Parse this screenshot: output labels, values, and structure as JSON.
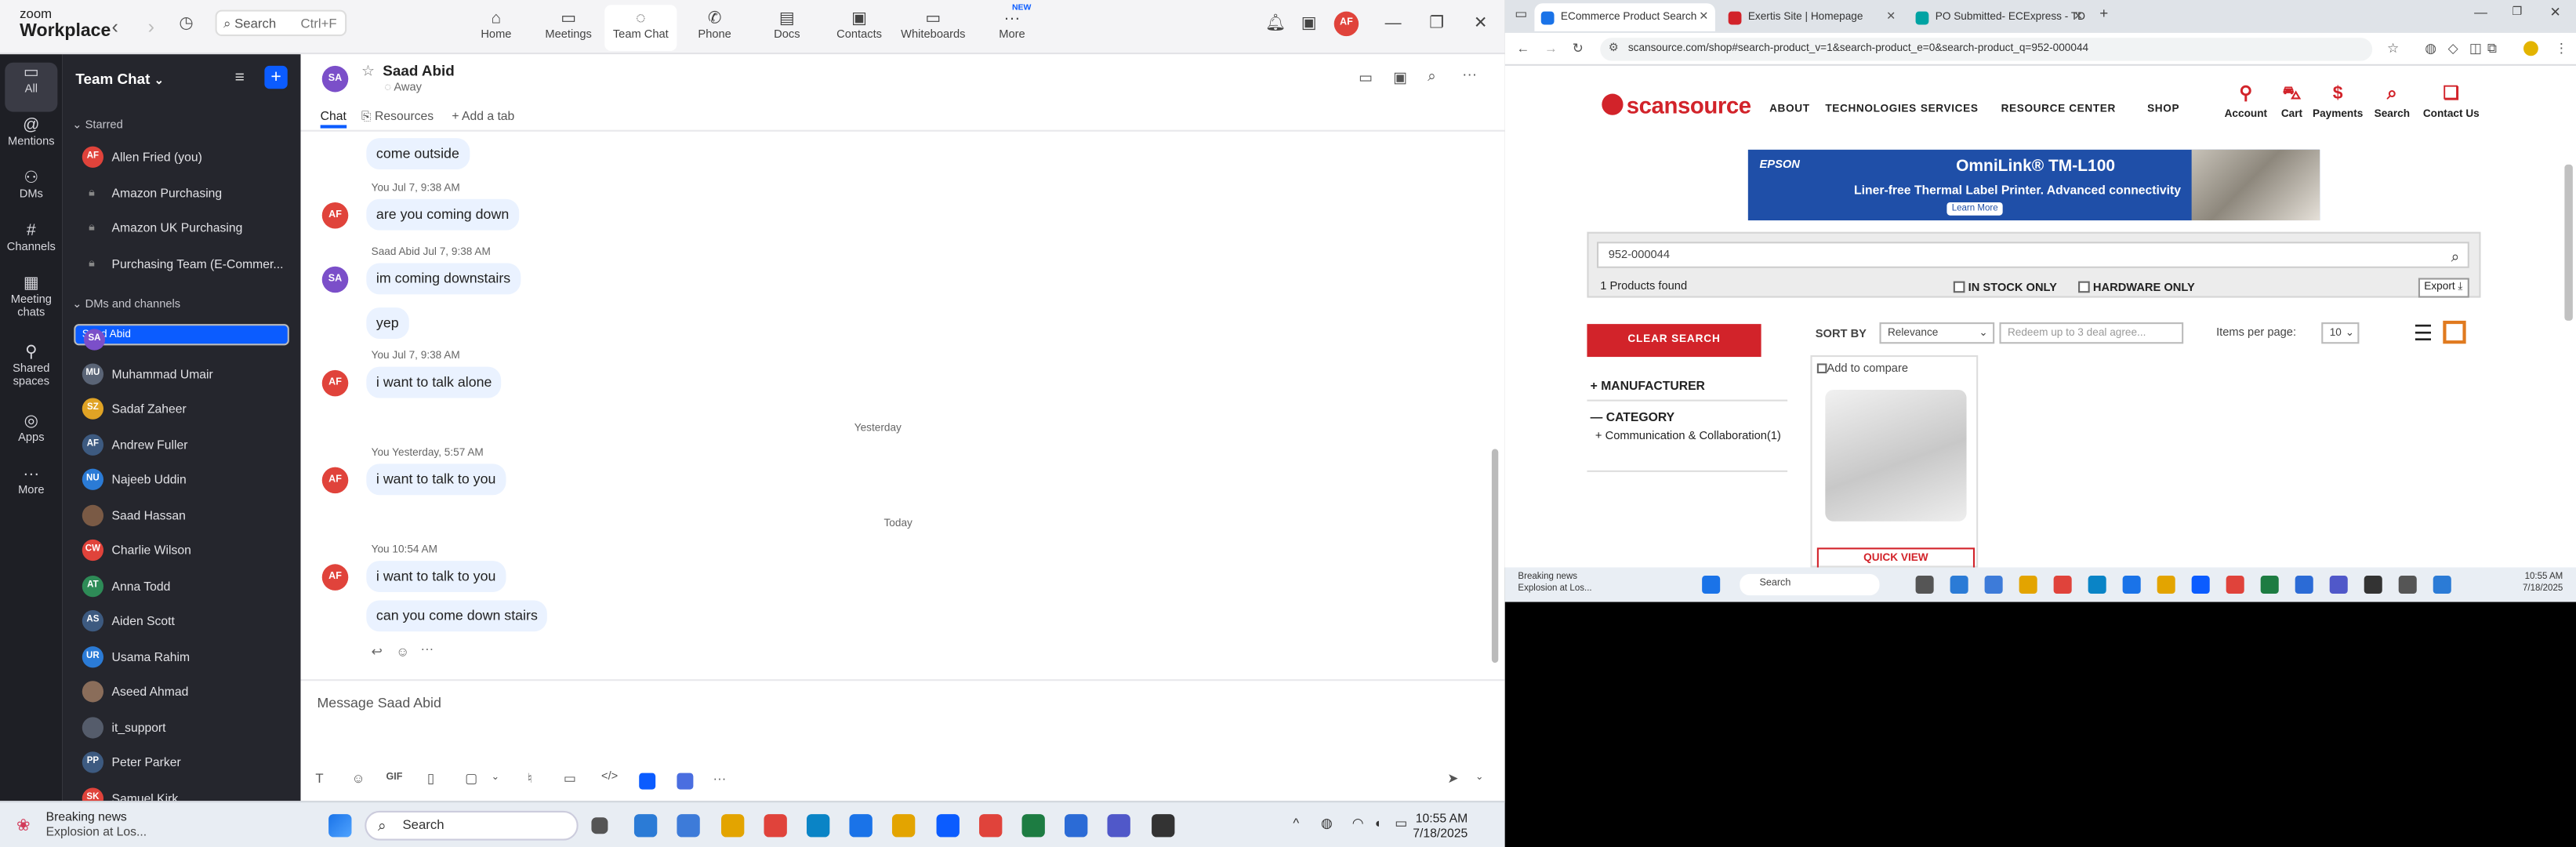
{
  "zoom": {
    "logo_small": "zoom",
    "logo_big": "Workplace",
    "search_label": "Search",
    "search_shortcut": "Ctrl+F",
    "nav": [
      {
        "label": "Home",
        "icon": "home-icon"
      },
      {
        "label": "Meetings",
        "icon": "video-icon"
      },
      {
        "label": "Team Chat",
        "icon": "chat-icon"
      },
      {
        "label": "Phone",
        "icon": "phone-icon"
      },
      {
        "label": "Docs",
        "icon": "docs-icon"
      },
      {
        "label": "Contacts",
        "icon": "contacts-icon"
      },
      {
        "label": "Whiteboards",
        "icon": "whiteboard-icon"
      },
      {
        "label": "More",
        "icon": "more-icon"
      }
    ],
    "new_badge": "NEW",
    "user_initials": "AF",
    "rail": [
      {
        "label": "All"
      },
      {
        "label": "Mentions"
      },
      {
        "label": "DMs"
      },
      {
        "label": "Channels"
      },
      {
        "label": "Meeting chats"
      },
      {
        "label": "Shared spaces"
      },
      {
        "label": "Apps"
      },
      {
        "label": "More"
      }
    ],
    "sidebar": {
      "title": "Team Chat",
      "starred_label": "Starred",
      "starred": [
        {
          "name": "Allen Fried (you)",
          "initials": "AF",
          "color": "#e0433b"
        },
        {
          "name": "Amazon Purchasing",
          "lock": true
        },
        {
          "name": "Amazon UK Purchasing",
          "lock": true
        },
        {
          "name": "Purchasing Team (E-Commer...",
          "lock": true
        }
      ],
      "dms_label": "DMs and channels",
      "dms": [
        {
          "name": "Saad Abid",
          "initials": "SA",
          "color": "#7b4fc9",
          "selected": true
        },
        {
          "name": "Muhammad Umair",
          "initials": "MU",
          "color": "#5a6476"
        },
        {
          "name": "Sadaf Zaheer",
          "initials": "SZ",
          "color": "#e0a325"
        },
        {
          "name": "Andrew Fuller",
          "initials": "AF",
          "color": "#3d5a80"
        },
        {
          "name": "Najeeb Uddin",
          "initials": "NU",
          "color": "#2b7bd6"
        },
        {
          "name": "Saad Hassan",
          "initials": "",
          "color": "#7a5a45"
        },
        {
          "name": "Charlie Wilson",
          "initials": "CW",
          "color": "#e0433b"
        },
        {
          "name": "Anna Todd",
          "initials": "AT",
          "color": "#2e8b57"
        },
        {
          "name": "Aiden Scott",
          "initials": "AS",
          "color": "#3d5a80"
        },
        {
          "name": "Usama Rahim",
          "initials": "UR",
          "color": "#2b7bd6"
        },
        {
          "name": "Aseed Ahmad",
          "initials": "",
          "color": "#8a6d5a"
        },
        {
          "name": "it_support",
          "initials": "",
          "color": "#555c6b"
        },
        {
          "name": "Peter Parker",
          "initials": "PP",
          "color": "#3d5a80"
        },
        {
          "name": "Samuel Kirk",
          "initials": "SK",
          "color": "#e0433b"
        }
      ]
    },
    "chat": {
      "name": "Saad Abid",
      "initials": "SA",
      "status": "Away",
      "tabs": [
        "Chat",
        "Resources",
        "+ Add a tab"
      ],
      "messages": [
        {
          "text": "come outside"
        },
        {
          "meta": "You Jul 7, 9:38 AM",
          "text": "are you coming down",
          "initials": "AF"
        },
        {
          "meta": "Saad Abid Jul 7, 9:38 AM",
          "text": "im coming downstairs",
          "initials": "SA"
        },
        {
          "text": "yep"
        },
        {
          "meta": "You Jul 7, 9:38 AM",
          "text": "i want to talk alone",
          "initials": "AF"
        },
        {
          "day": "Yesterday"
        },
        {
          "meta": "You Yesterday, 5:57 AM",
          "text": "i want to talk to you",
          "initials": "AF"
        },
        {
          "day": "Today"
        },
        {
          "meta": "You 10:54 AM",
          "text": "i want to talk to you",
          "initials": "AF"
        },
        {
          "text": "can you come down stairs"
        }
      ],
      "compose_placeholder": "Message Saad Abid",
      "gif_label": "GIF"
    }
  },
  "chrome": {
    "tabs": [
      {
        "title": "ECommerce Product Search",
        "color": "#1a73e8"
      },
      {
        "title": "Exertis Site | Homepage",
        "color": "#d2232a"
      },
      {
        "title": "PO Submitted- ECExpress - TD",
        "color": "#00a3a3"
      }
    ],
    "url": "scansource.com/shop#search-product_v=1&search-product_e=0&search-product_q=952-000044",
    "site": {
      "logo": "scansource",
      "nav": [
        "ABOUT",
        "TECHNOLOGIES",
        "SERVICES",
        "RESOURCE CENTER",
        "SHOP"
      ],
      "account": [
        {
          "label": "Account",
          "icon": "person-icon"
        },
        {
          "label": "Cart",
          "icon": "cart-icon"
        },
        {
          "label": "Payments",
          "icon": "dollar-icon"
        },
        {
          "label": "Search",
          "icon": "search-icon"
        },
        {
          "label": "Contact Us",
          "icon": "chat-bubbles-icon"
        }
      ],
      "banner": {
        "brand": "EPSON",
        "title": "OmniLink® TM-L100",
        "subtitle": "Liner-free Thermal Label Printer.  Advanced connectivity",
        "cta": "Learn More"
      },
      "search_value": "952-000044",
      "found": "1 Products found",
      "in_stock": "IN STOCK ONLY",
      "hardware": "HARDWARE ONLY",
      "export": "Export ⤓",
      "clear": "CLEAR SEARCH",
      "sort_label": "SORT BY",
      "sort_value": "Relevance",
      "redeem_placeholder": "Redeem up to 3 deal agree...",
      "ipp_label": "Items per page:",
      "ipp_value": "10",
      "manufacturer": "MANUFACTURER",
      "category": "CATEGORY",
      "category_item": "Communication & Collaboration(1)",
      "compare": "Add to compare",
      "quick_view": "QUICK VIEW"
    }
  },
  "taskbar_inner": {
    "news_title": "Breaking news",
    "news_sub": "Explosion at Los...",
    "search": "Search",
    "time": "10:55 AM",
    "date": "7/18/2025"
  },
  "taskbar": {
    "news_title": "Breaking news",
    "news_sub": "Explosion at Los...",
    "search": "Search",
    "time": "10:55 AM",
    "date": "7/18/2025"
  }
}
